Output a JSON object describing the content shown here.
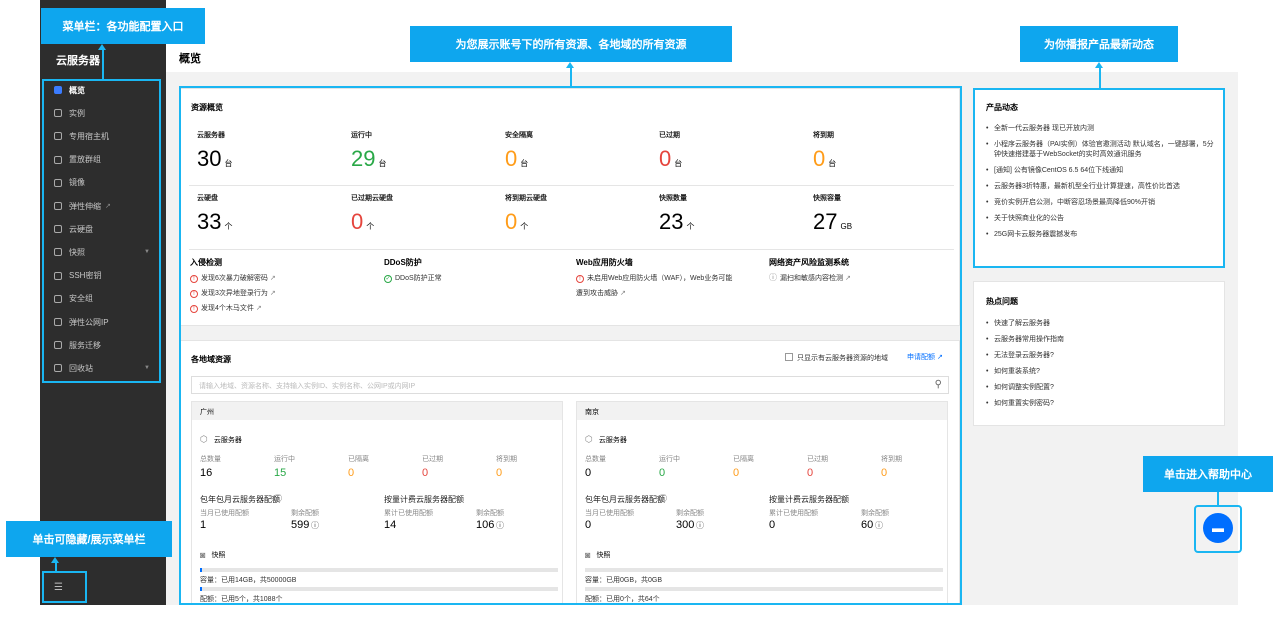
{
  "annotations": {
    "menu_bar": "菜单栏：各功能配置入口",
    "overview": "为您展示账号下的所有资源、各地域的所有资源",
    "news": "为你播报产品最新动态",
    "toggle_menu": "单击可隐藏/展示菜单栏",
    "help": "单击进入帮助中心"
  },
  "sidebar": {
    "title": "云服务器",
    "items": [
      {
        "label": "概览",
        "icon": "grid-icon",
        "active": true
      },
      {
        "label": "实例",
        "icon": "cube-icon"
      },
      {
        "label": "专用宿主机",
        "icon": "cube-icon"
      },
      {
        "label": "置放群组",
        "icon": "group-icon"
      },
      {
        "label": "镜像",
        "icon": "disc-icon"
      },
      {
        "label": "弹性伸缩",
        "icon": "scale-icon",
        "external": true
      },
      {
        "label": "云硬盘",
        "icon": "disk-icon"
      },
      {
        "label": "快照",
        "icon": "camera-icon",
        "caret": true
      },
      {
        "label": "SSH密钥",
        "icon": "key-icon"
      },
      {
        "label": "安全组",
        "icon": "shield-icon"
      },
      {
        "label": "弹性公网IP",
        "icon": "ip-icon"
      },
      {
        "label": "服务迁移",
        "icon": "migrate-icon"
      },
      {
        "label": "回收站",
        "icon": "trash-icon",
        "caret": true
      }
    ]
  },
  "page_title": "概览",
  "overview": {
    "title": "资源概览",
    "stats_row1": [
      {
        "label": "云服务器",
        "value": "30",
        "unit": "台",
        "color": "#000000"
      },
      {
        "label": "运行中",
        "value": "29",
        "unit": "台",
        "color": "#29a847"
      },
      {
        "label": "安全隔离",
        "value": "0",
        "unit": "台",
        "color": "#ff9c19"
      },
      {
        "label": "已过期",
        "value": "0",
        "unit": "台",
        "color": "#e5453d"
      },
      {
        "label": "将到期",
        "value": "0",
        "unit": "台",
        "color": "#ff9c19"
      }
    ],
    "stats_row2": [
      {
        "label": "云硬盘",
        "value": "33",
        "unit": "个",
        "color": "#000000"
      },
      {
        "label": "已过期云硬盘",
        "value": "0",
        "unit": "个",
        "color": "#e5453d"
      },
      {
        "label": "将到期云硬盘",
        "value": "0",
        "unit": "个",
        "color": "#ff9c19"
      },
      {
        "label": "快照数量",
        "value": "23",
        "unit": "个",
        "color": "#000000"
      },
      {
        "label": "快照容量",
        "value": "27",
        "unit": "GB",
        "color": "#000000"
      }
    ],
    "security": [
      {
        "title": "入侵检测",
        "lines": [
          "发现6次暴力破解密码",
          "发现3次异地登录行为",
          "发现4个木马文件"
        ]
      },
      {
        "title": "DDoS防护",
        "lines": [
          "DDoS防护正常"
        ]
      },
      {
        "title": "Web应用防火墙",
        "lines": [
          "未启用Web应用防火墙（WAF），Web业务可能",
          "遭到攻击威胁"
        ]
      },
      {
        "title": "网络资产风险监测系统",
        "lines": [
          "漏扫和敏感内容检测"
        ]
      }
    ]
  },
  "regions": {
    "title": "各地域资源",
    "checkbox_label": "只显示有云服务器资源的地域",
    "apply_link": "申请配额",
    "search_placeholder": "请输入地域、资源名称、支持输入实例ID、实例名称、公网IP或内网IP",
    "list": [
      {
        "name": "广州",
        "cvm_title": "云服务器",
        "labels": [
          "总数量",
          "运行中",
          "已隔离",
          "已过期",
          "将到期"
        ],
        "values": [
          "16",
          "15",
          "0",
          "0",
          "0"
        ],
        "monthly_title": "包年包月云服务器配额",
        "monthly_used_label": "当月已使用配额",
        "monthly_used": "1",
        "monthly_left_label": "剩余配额",
        "monthly_left": "599",
        "hourly_title": "按量计费云服务器配额",
        "hourly_used_label": "累计已使用配额",
        "hourly_used": "14",
        "hourly_left_label": "剩余配额",
        "hourly_left": "106",
        "snapshot_title": "快照",
        "capacity": "容量：已用14GB，共50000GB",
        "quota": "配额：已用5个，共1088个",
        "capacity_fraction": 0.0003,
        "quota_fraction": 0.005
      },
      {
        "name": "南京",
        "cvm_title": "云服务器",
        "labels": [
          "总数量",
          "运行中",
          "已隔离",
          "已过期",
          "将到期"
        ],
        "values": [
          "0",
          "0",
          "0",
          "0",
          "0"
        ],
        "monthly_title": "包年包月云服务器配额",
        "monthly_used_label": "当月已使用配额",
        "monthly_used": "0",
        "monthly_left_label": "剩余配额",
        "monthly_left": "300",
        "hourly_title": "按量计费云服务器配额",
        "hourly_used_label": "累计已使用配额",
        "hourly_used": "0",
        "hourly_left_label": "剩余配额",
        "hourly_left": "60",
        "snapshot_title": "快照",
        "capacity": "容量：已用0GB，共0GB",
        "quota": "配额：已用0个，共64个",
        "capacity_fraction": 0,
        "quota_fraction": 0
      }
    ]
  },
  "news": {
    "title": "产品动态",
    "items": [
      "全新一代云服务器 现已开放内测",
      "小程序云服务器（PAI实例）体验官邀测活动 默认域名，一键部署，5分钟快速搭建基于WebSocket的实时高效通讯服务",
      "[通知] 公有镜像CentOS 6.5 64位下线通知",
      "云服务器3折特惠，最新机型全行业计算提速，高性价比首选",
      "竞价实例开启公测，中断容忍场景最高降低90%开销",
      "关于快照商业化的公告",
      "25G网卡云服务器震撼发布"
    ]
  },
  "faq": {
    "title": "热点问题",
    "items": [
      "快速了解云服务器",
      "云服务器常用操作指南",
      "无法登录云服务器?",
      "如何重装系统?",
      "如何调整实例配置?",
      "如何重置实例密码?"
    ]
  },
  "colors": {
    "accent": "#1ab6f2",
    "brand": "#006eff",
    "sidebar": "#2d2d2d"
  }
}
